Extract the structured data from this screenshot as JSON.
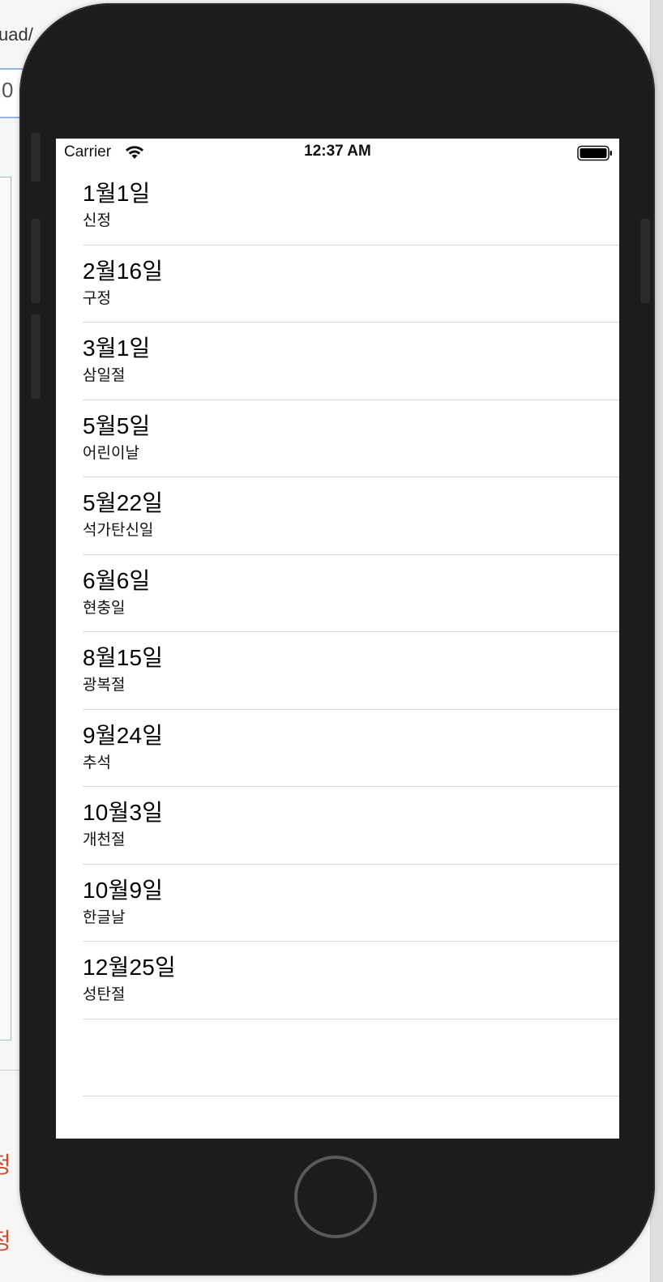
{
  "background": {
    "path_fragment": "uad/",
    "field_value": "0",
    "side_chars": [
      "정",
      "정"
    ]
  },
  "status_bar": {
    "carrier": "Carrier",
    "time": "12:37 AM",
    "wifi_icon": "wifi-icon",
    "battery_icon": "battery-icon"
  },
  "holidays": [
    {
      "date": "1월1일",
      "name": "신정"
    },
    {
      "date": "2월16일",
      "name": "구정"
    },
    {
      "date": "3월1일",
      "name": "삼일절"
    },
    {
      "date": "5월5일",
      "name": "어린이날"
    },
    {
      "date": "5월22일",
      "name": "석가탄신일"
    },
    {
      "date": "6월6일",
      "name": "현충일"
    },
    {
      "date": "8월15일",
      "name": "광복절"
    },
    {
      "date": "9월24일",
      "name": "추석"
    },
    {
      "date": "10월3일",
      "name": "개천절"
    },
    {
      "date": "10월9일",
      "name": "한글날"
    },
    {
      "date": "12월25일",
      "name": "성탄절"
    }
  ],
  "colors": {
    "device": "#1c1c1c",
    "screen": "#ffffff",
    "separator": "#d9d9d9",
    "home_ring": "#5a5a5a"
  }
}
